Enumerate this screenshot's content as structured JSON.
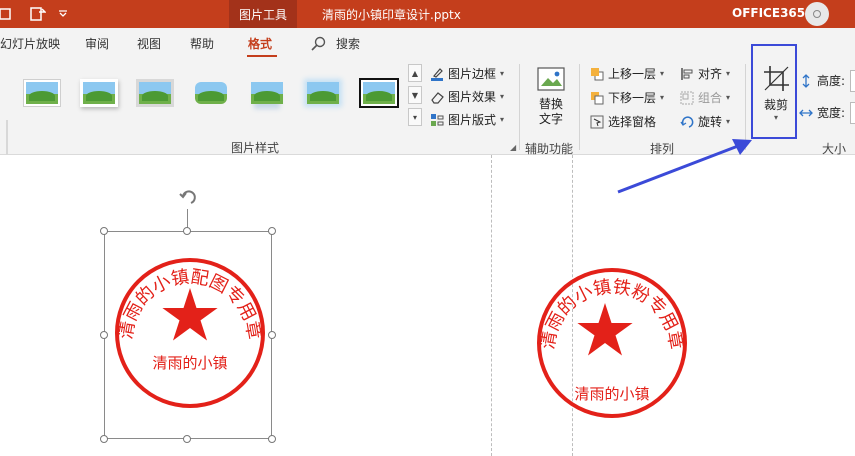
{
  "titlebar": {
    "picture_tools": "图片工具",
    "document_title": "清雨的小镇印章设计.pptx",
    "account_name": "OFFICE365",
    "colors": {
      "ribbon_accent": "#c43e1c",
      "context_tab": "#a3321a"
    }
  },
  "tabs": [
    {
      "label": "幻灯片放映"
    },
    {
      "label": "审阅"
    },
    {
      "label": "视图"
    },
    {
      "label": "帮助"
    },
    {
      "label": "格式",
      "active": true
    }
  ],
  "search": {
    "label": "搜索",
    "icon": "search-icon"
  },
  "ribbon": {
    "picture_styles": {
      "label": "图片样式",
      "commands": [
        {
          "label": "图片边框",
          "icon": "pen-icon"
        },
        {
          "label": "图片效果",
          "icon": "eraser-icon"
        },
        {
          "label": "图片版式",
          "icon": "layout-icon"
        }
      ]
    },
    "accessibility": {
      "label": "辅助功能",
      "alt_text_line1": "替换",
      "alt_text_line2": "文字"
    },
    "arrange": {
      "label": "排列",
      "bring_forward": "上移一层",
      "send_backward": "下移一层",
      "selection_pane": "选择窗格",
      "align": "对齐",
      "group": "组合",
      "rotate": "旋转"
    },
    "size": {
      "label": "大小",
      "crop": "裁剪",
      "height_label": "高度:",
      "width_label": "宽度:"
    }
  },
  "slide": {
    "seal_left": {
      "arc_text": "清雨的小镇配图专用章",
      "bottom_text": "清雨的小镇",
      "color": "#e32119"
    },
    "seal_right": {
      "arc_text": "清雨的小镇铁粉专用章",
      "bottom_text": "清雨的小镇",
      "color": "#e32119"
    }
  },
  "annotation": {
    "highlight_color": "#3b4ad8"
  }
}
